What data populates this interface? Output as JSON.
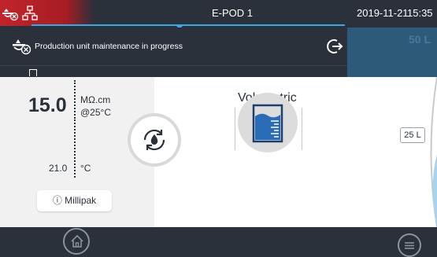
{
  "status_bar": {
    "title": "E-POD 1",
    "date": "2019-11-21",
    "time": "15:35",
    "icons": [
      "water-alarm-icon",
      "network-icon"
    ]
  },
  "notification": {
    "text": "Production unit maintenance in progress",
    "icon": "maintenance-alert-icon",
    "action_icon": "exit-icon"
  },
  "tank": {
    "volume_label": "50 L",
    "marker_label": "25 L"
  },
  "measurement": {
    "resistivity_value": "15.0",
    "resistivity_unit": "MΩ.cm",
    "resistivity_reference": "@25°C",
    "temperature_value": "21.0",
    "temperature_unit": "°C",
    "pack_label": "Millipak",
    "pack_icon": "info-icon"
  },
  "dispense": {
    "mode_label": "Volumetric",
    "recirculation_icon": "recirculation-drop-icon",
    "volumetric_icon": "graduated-cylinder-icon"
  },
  "bottom_bar": {
    "home_icon": "home-icon",
    "menu_icon": "menu-icon"
  },
  "colors": {
    "alarm_red": "#c1242b",
    "accent_blue": "#3da4e8",
    "dark_bar": "#2a313b",
    "tank_blue": "#2e5a79"
  }
}
